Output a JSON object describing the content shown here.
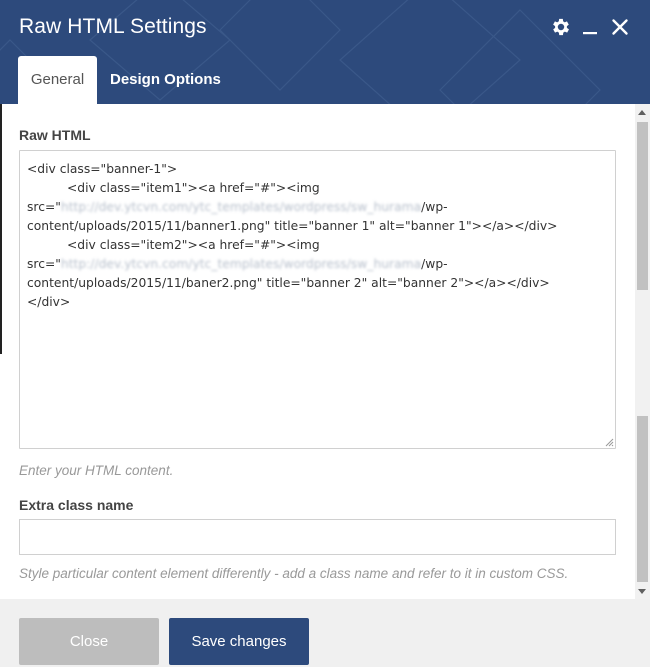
{
  "dialog": {
    "title": "Raw HTML Settings"
  },
  "icons": {
    "settings": "gear-icon",
    "minimize": "minimize-icon",
    "close": "close-icon"
  },
  "tabs": [
    {
      "label": "General",
      "active": true
    },
    {
      "label": "Design Options",
      "active": false
    }
  ],
  "raw_html": {
    "label": "Raw HTML",
    "lines": [
      {
        "pre": "<div class=\"banner-1\">",
        "blur": "",
        "post": "",
        "indent": false
      },
      {
        "pre": "<div class=\"item1\"><a href=\"#\"><img",
        "blur": "",
        "post": "",
        "indent": true
      },
      {
        "pre": "src=\"",
        "blur": "http://dev.ytcvn.com/ytc_templates/wordpress/sw_hurama",
        "post": "/wp-",
        "indent": false
      },
      {
        "pre": "content/uploads/2015/11/banner1.png\" title=\"banner 1\" alt=\"banner 1\"></a></div>",
        "blur": "",
        "post": "",
        "indent": false
      },
      {
        "pre": "<div class=\"item2\"><a href=\"#\"><img",
        "blur": "",
        "post": "",
        "indent": true
      },
      {
        "pre": "src=\"",
        "blur": "http://dev.ytcvn.com/ytc_templates/wordpress/sw_hurama",
        "post": "/wp-",
        "indent": false
      },
      {
        "pre": "content/uploads/2015/11/baner2.png\" title=\"banner 2\" alt=\"banner 2\"></a></div>",
        "blur": "",
        "post": "",
        "indent": false
      },
      {
        "pre": "</div>",
        "blur": "",
        "post": "",
        "indent": false
      }
    ],
    "help": "Enter your HTML content."
  },
  "extra_class": {
    "label": "Extra class name",
    "value": "",
    "help": "Style particular content element differently - add a class name and refer to it in custom CSS."
  },
  "footer": {
    "close_label": "Close",
    "save_label": "Save changes"
  },
  "colors": {
    "header": "#2d4a7c",
    "save_button": "#2d4a7c",
    "close_button": "#bdbdbd"
  }
}
